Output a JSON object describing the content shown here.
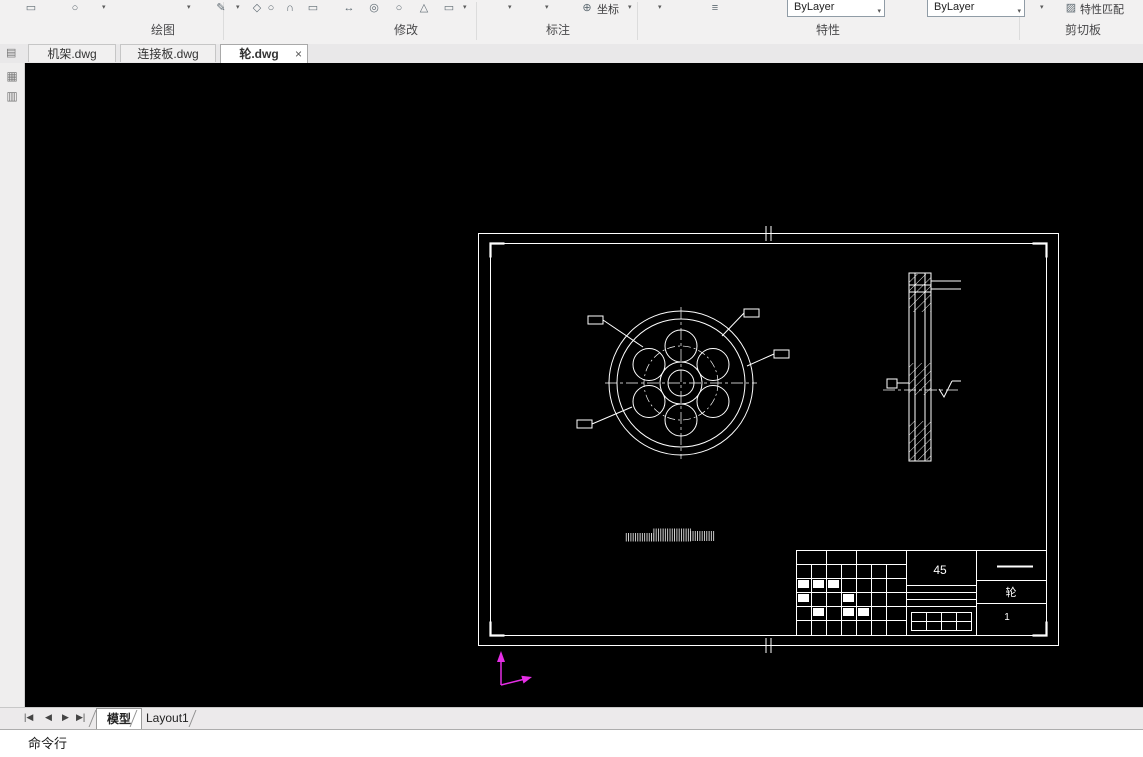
{
  "ribbon": {
    "groups": [
      {
        "label": "绘图"
      },
      {
        "label": "修改"
      },
      {
        "label": "标注"
      },
      {
        "label": "特性"
      },
      {
        "label": "剪切板"
      }
    ],
    "coord_label": "坐标",
    "layer_combo1": "ByLayer",
    "layer_combo2": "ByLayer",
    "match_label": "特性匹配"
  },
  "doc_tabs": [
    {
      "label": "机架.dwg"
    },
    {
      "label": "连接板.dwg"
    },
    {
      "label": "轮.dwg"
    }
  ],
  "drawing": {
    "titleblock": {
      "material": "45",
      "part_name": "轮",
      "quantity": "1"
    }
  },
  "layout": {
    "model": "模型",
    "layout1": "Layout1"
  },
  "command_line": {
    "label": "命令行"
  },
  "icons": {
    "caret": "▾",
    "close": "×",
    "pencil": "✎",
    "rect": "▭",
    "circle": "○",
    "ring": "◎",
    "diamond": "◇",
    "cap": "∩",
    "arrow_h": "↔",
    "triangle": "△",
    "target": "⊕",
    "layers": "≡",
    "hatch": "▨",
    "page": "▤",
    "grid": "▦",
    "rows": "▥",
    "nav_first": "|◀",
    "nav_prev": "◀",
    "nav_next": "▶",
    "nav_last": "▶|"
  }
}
